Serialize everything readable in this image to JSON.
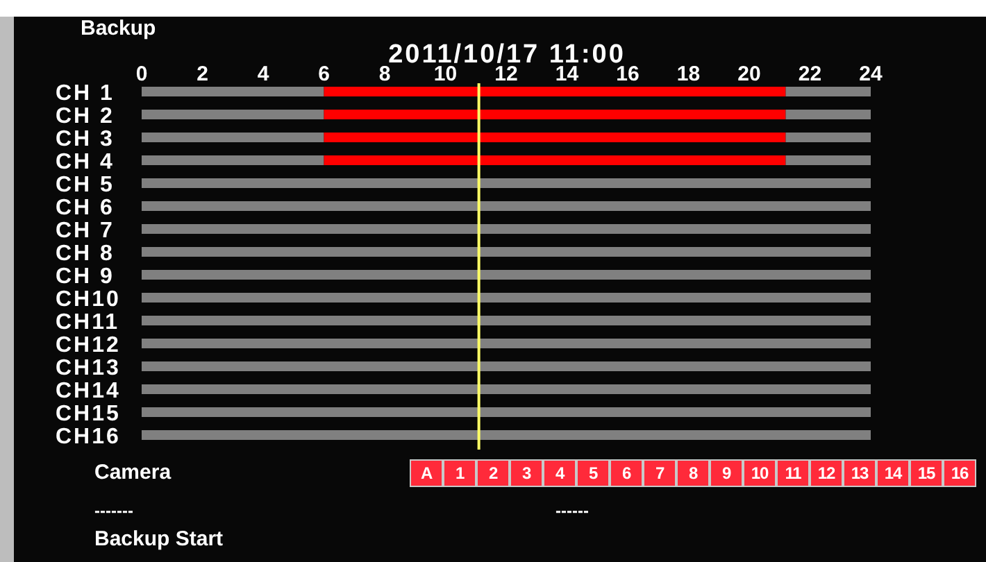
{
  "title": "Backup",
  "timeline": {
    "chart_data": {
      "type": "bar",
      "orientation": "horizontal",
      "stacked": true,
      "title": "2011/10/17 11:00",
      "categories": [
        "CH 1",
        "CH 2",
        "CH 3",
        "CH 4",
        "CH 5",
        "CH 6",
        "CH 7",
        "CH 8",
        "CH 9",
        "CH10",
        "CH11",
        "CH12",
        "CH13",
        "CH14",
        "CH15",
        "CH16"
      ],
      "series": [
        {
          "color": "#808080",
          "values": [
            6,
            6,
            6,
            6,
            24,
            24,
            24,
            24,
            24,
            24,
            24,
            24,
            24,
            24,
            24,
            24
          ]
        },
        {
          "color": "#ff0000",
          "values": [
            15.2,
            15.2,
            15.2,
            15.2,
            0,
            0,
            0,
            0,
            0,
            0,
            0,
            0,
            0,
            0,
            0,
            0
          ]
        },
        {
          "color": "#808080",
          "values": [
            2.8,
            2.8,
            2.8,
            2.8,
            0,
            0,
            0,
            0,
            0,
            0,
            0,
            0,
            0,
            0,
            0,
            0
          ]
        }
      ],
      "xlim": [
        0,
        24
      ],
      "xticks": [
        0,
        2,
        4,
        6,
        8,
        10,
        12,
        14,
        16,
        18,
        20,
        22,
        24
      ],
      "ref_lines": [
        {
          "axis": "x",
          "value": 11.1,
          "color": "#ffff66"
        }
      ]
    }
  },
  "camera": {
    "label": "Camera",
    "buttons": [
      {
        "label": "A",
        "selected": true
      },
      {
        "label": "1",
        "selected": true
      },
      {
        "label": "2",
        "selected": true
      },
      {
        "label": "3",
        "selected": true
      },
      {
        "label": "4",
        "selected": true
      },
      {
        "label": "5",
        "selected": true
      },
      {
        "label": "6",
        "selected": true
      },
      {
        "label": "7",
        "selected": true
      },
      {
        "label": "8",
        "selected": true
      },
      {
        "label": "9",
        "selected": true
      },
      {
        "label": "10",
        "selected": true
      },
      {
        "label": "11",
        "selected": true
      },
      {
        "label": "12",
        "selected": true
      },
      {
        "label": "13",
        "selected": true
      },
      {
        "label": "14",
        "selected": true
      },
      {
        "label": "15",
        "selected": true
      },
      {
        "label": "16",
        "selected": true
      }
    ]
  },
  "field_1": "-------",
  "field_2": "------",
  "action": "Backup Start"
}
